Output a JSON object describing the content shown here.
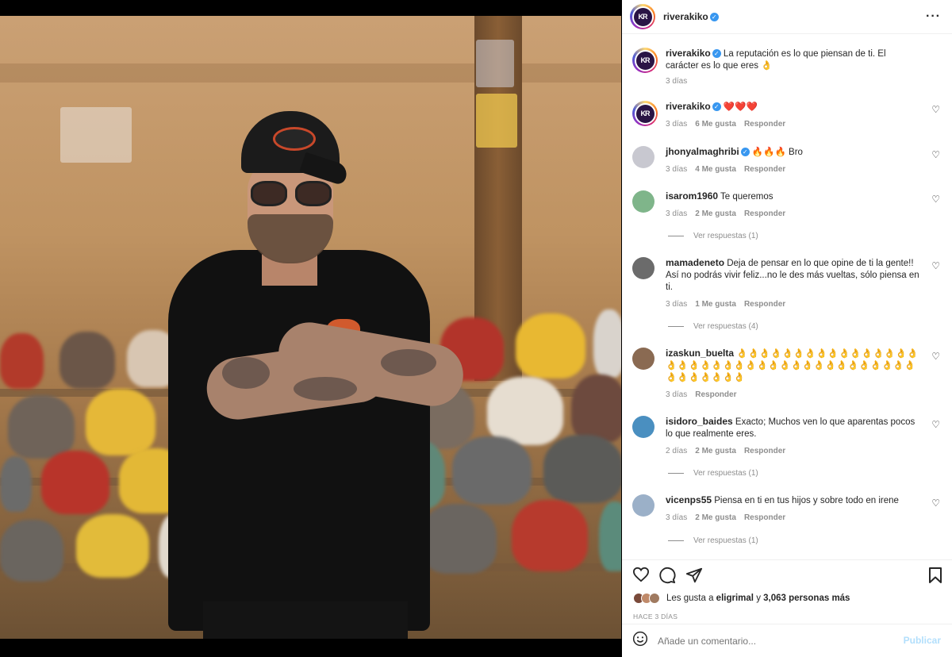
{
  "post_author": {
    "username": "riverakiko",
    "avatar_initials": "KR",
    "verified": true
  },
  "caption": {
    "username": "riverakiko",
    "text": "La reputación es lo que piensan de ti. El carácter es lo que eres 👌",
    "time": "3 días"
  },
  "comments": [
    {
      "username": "riverakiko",
      "verified": true,
      "text": "❤️❤️❤️",
      "time": "3 días",
      "likes": "6 Me gusta",
      "reply_label": "Responder",
      "avatar_color": "#2a1445",
      "avatar_initials": "KR"
    },
    {
      "username": "jhonyalmaghribi",
      "verified": true,
      "text": "🔥🔥🔥 Bro",
      "time": "3 días",
      "likes": "4 Me gusta",
      "reply_label": "Responder",
      "avatar_color": "#c8c8d0"
    },
    {
      "username": "isarom1960",
      "text": "Te queremos",
      "time": "3 días",
      "likes": "2 Me gusta",
      "reply_label": "Responder",
      "replies": "Ver respuestas (1)",
      "avatar_color": "#7fb58a"
    },
    {
      "username": "mamadeneto",
      "text": "Deja de pensar en lo que opine de ti la gente!! Así no podrás vivir feliz...no le des más vueltas, sólo piensa en ti.",
      "time": "3 días",
      "likes": "1 Me gusta",
      "reply_label": "Responder",
      "replies": "Ver respuestas (4)",
      "avatar_color": "#6b6b6b"
    },
    {
      "username": "izaskun_buelta",
      "text": "👌👌👌👌👌👌👌👌👌👌👌👌👌👌👌👌👌👌👌👌👌👌👌👌👌👌👌👌👌👌👌👌👌👌👌👌👌👌👌👌👌👌👌👌👌",
      "time": "3 días",
      "reply_label": "Responder",
      "avatar_color": "#8a6a52"
    },
    {
      "username": "isidoro_baides",
      "text": "Exacto; Muchos ven lo que aparentas pocos lo que realmente eres.",
      "time": "2 días",
      "likes": "2 Me gusta",
      "reply_label": "Responder",
      "replies": "Ver respuestas (1)",
      "avatar_color": "#4a8fc0"
    },
    {
      "username": "vicenps55",
      "text": "Piensa en ti en tus hijos y sobre todo en irene",
      "time": "3 días",
      "likes": "2 Me gusta",
      "reply_label": "Responder",
      "replies": "Ver respuestas (1)",
      "avatar_color": "#9bb0c8"
    }
  ],
  "likes_summary": {
    "prefix": "Les gusta a",
    "user": "eligrimal",
    "connector": "y",
    "others": "3,063 personas más"
  },
  "posted_ago": "HACE 3 DÍAS",
  "add_comment": {
    "placeholder": "Añade un comentario...",
    "publish_label": "Publicar"
  },
  "icons": {
    "like": "heart-outline-icon",
    "comment": "comment-bubble-icon",
    "share": "paper-plane-icon",
    "save": "bookmark-icon",
    "emoji": "smiley-icon",
    "more": "ellipsis-icon"
  },
  "colors": {
    "verified": "#3897f0",
    "publish_disabled": "#b2dffc",
    "meta_text": "#8e8e8e"
  }
}
